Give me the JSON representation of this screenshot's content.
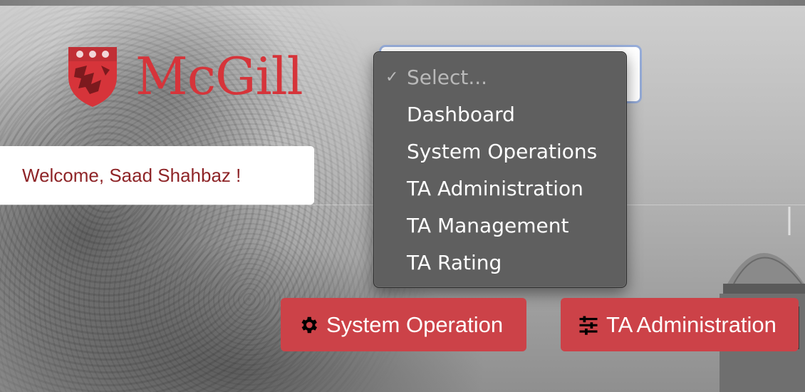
{
  "logo": {
    "wordmark": "McGill",
    "brand_color": "#d6343a"
  },
  "welcome": {
    "text": "Welcome, Saad Shahbaz !"
  },
  "select": {
    "selected": "Select...",
    "options": [
      "Dashboard",
      "System Operations",
      "TA Administration",
      "TA Management",
      "TA Rating"
    ]
  },
  "buttons": {
    "system_operation": {
      "label": "System Operation",
      "icon": "gear-icon"
    },
    "ta_administration": {
      "label": "TA Administration",
      "icon": "sliders-icon"
    }
  },
  "colors": {
    "button_bg": "#cc4248",
    "welcome_text": "#8e2427",
    "dropdown_bg": "#5f5f5f"
  }
}
